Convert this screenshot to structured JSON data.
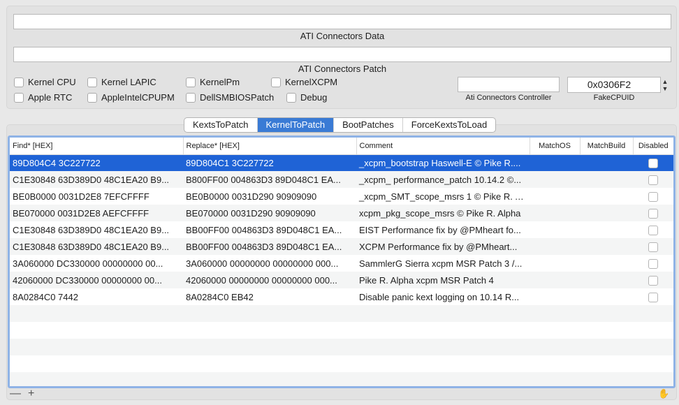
{
  "ati": {
    "data_value": "",
    "data_label": "ATI Connectors Data",
    "patch_value": "",
    "patch_label": "ATI Connectors Patch",
    "controller_value": "",
    "controller_label": "Ati Connectors Controller",
    "fakecpuid_value": "0x0306F2",
    "fakecpuid_label": "FakeCPUID"
  },
  "checkboxes": {
    "kernel_cpu": "Kernel CPU",
    "kernel_lapic": "Kernel LAPIC",
    "kernel_pm": "KernelPm",
    "kernel_xcpm": "KernelXCPM",
    "apple_rtc": "Apple RTC",
    "apple_intel_cpupm": "AppleIntelCPUPM",
    "dell_smbios_patch": "DellSMBIOSPatch",
    "debug": "Debug"
  },
  "tabs": [
    "KextsToPatch",
    "KernelToPatch",
    "BootPatches",
    "ForceKextsToLoad"
  ],
  "active_tab": "KernelToPatch",
  "columns": [
    "Find* [HEX]",
    "Replace* [HEX]",
    "Comment",
    "MatchOS",
    "MatchBuild",
    "Disabled"
  ],
  "rows": [
    {
      "find": "89D804C4 3C227722",
      "replace": "89D804C1 3C227722",
      "comment": "_xcpm_bootstrap Haswell-E © Pike R....",
      "matchos": "",
      "matchbuild": ""
    },
    {
      "find": "C1E30848 63D389D0 48C1EA20 B9...",
      "replace": "B800FF00 004863D3 89D048C1 EA...",
      "comment": "_xcpm_ performance_patch 10.14.2 ©...",
      "matchos": "",
      "matchbuild": ""
    },
    {
      "find": "BE0B0000 0031D2E8 7EFCFFFF",
      "replace": "BE0B0000 0031D290 90909090",
      "comment": "_xcpm_SMT_scope_msrs 1 © Pike R. A...",
      "matchos": "",
      "matchbuild": ""
    },
    {
      "find": "BE070000 0031D2E8 AEFCFFFF",
      "replace": "BE070000 0031D290 90909090",
      "comment": "xcpm_pkg_scope_msrs © Pike R. Alpha",
      "matchos": "",
      "matchbuild": ""
    },
    {
      "find": "C1E30848 63D389D0 48C1EA20 B9...",
      "replace": "BB00FF00 004863D3 89D048C1 EA...",
      "comment": "EIST Performance fix by @PMheart fo...",
      "matchos": "",
      "matchbuild": ""
    },
    {
      "find": "C1E30848 63D389D0 48C1EA20 B9...",
      "replace": "BB00FF00 004863D3 89D048C1 EA...",
      "comment": "XCPM Performance fix by @PMheart...",
      "matchos": "",
      "matchbuild": ""
    },
    {
      "find": "3A060000 DC330000 00000000 00...",
      "replace": "3A060000 00000000 00000000 000...",
      "comment": "SammlerG Sierra xcpm MSR Patch 3 /...",
      "matchos": "",
      "matchbuild": ""
    },
    {
      "find": "42060000 DC330000 00000000 00...",
      "replace": "42060000 00000000 00000000 000...",
      "comment": "Pike R. Alpha xcpm MSR Patch 4",
      "matchos": "",
      "matchbuild": ""
    },
    {
      "find": "8A0284C0 7442",
      "replace": "8A0284C0 EB42",
      "comment": "Disable panic kext logging on 10.14 R...",
      "matchos": "",
      "matchbuild": ""
    }
  ],
  "selected_row": 0,
  "footer": {
    "remove": "—",
    "add": "+"
  },
  "colors": {
    "accent": "#1f63d6",
    "active_tab": "#3a7bd5",
    "focus_ring": "#8fb3e6"
  }
}
